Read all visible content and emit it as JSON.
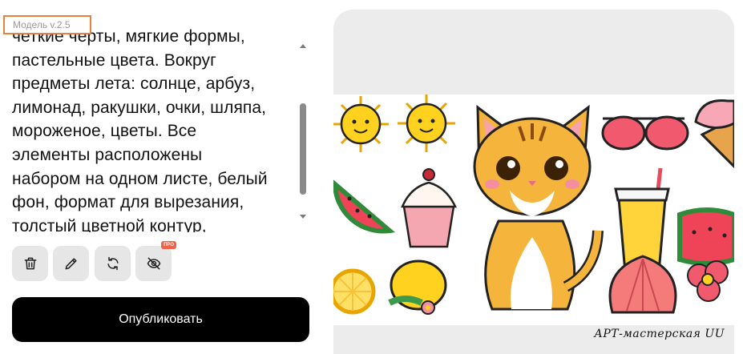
{
  "model_tag": "Модель  v.2.5",
  "prompt": {
    "text": "четкие черты, мягкие формы,\nпастельные цвета. Вокруг\nпредметы лета: солнце, арбуз,\nлимонад, ракушки, очки, шляпа,\nмороженое, цветы. Все\nэлементы расположены\nнабором на одном листе, белый\nфон, формат для вырезания,\nтолстый цветной контур,"
  },
  "toolbar": {
    "delete_icon": "trash-icon",
    "edit_icon": "pencil-icon",
    "regenerate_icon": "refresh-icon",
    "hide_icon": "eye-off-icon",
    "pro_badge": "ПРО"
  },
  "publish_label": "Опубликовать",
  "image": {
    "signature": "АРТ-мастерская UU",
    "subjects": [
      "sun",
      "sun",
      "cat",
      "sunglasses",
      "ice-cream-cone",
      "watermelon",
      "cupcake",
      "lemonade",
      "watermelon",
      "lemon",
      "lemon-with-flowers",
      "shell",
      "flower"
    ]
  },
  "colors": {
    "accent": "#e8823a",
    "publish_bg": "#000000",
    "pro_badge": "#f0614a"
  }
}
